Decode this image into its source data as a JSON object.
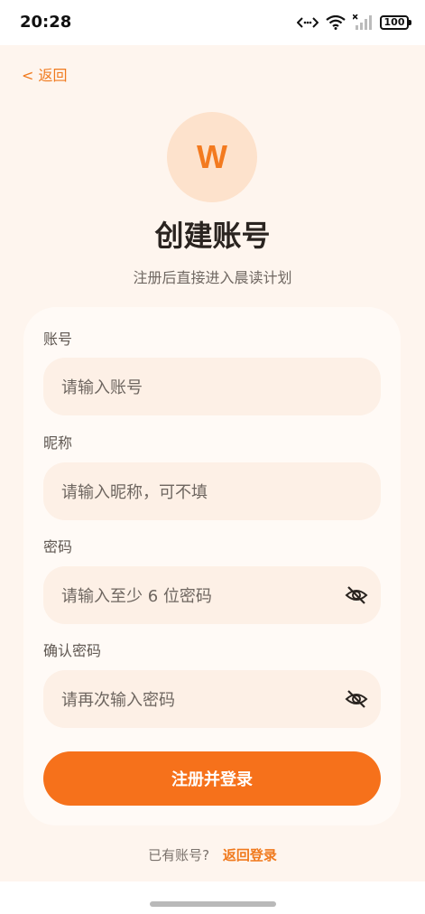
{
  "status_bar": {
    "time": "20:28",
    "battery": "100",
    "icons": [
      "signal-dots-icon",
      "wifi-icon",
      "cellular-icon",
      "battery-icon"
    ]
  },
  "nav": {
    "back_label": "< 返回"
  },
  "logo": {
    "letter": "W"
  },
  "header": {
    "title": "创建账号",
    "subtitle": "注册后直接进入晨读计划"
  },
  "form": {
    "account": {
      "label": "账号",
      "placeholder": "请输入账号"
    },
    "nickname": {
      "label": "昵称",
      "placeholder": "请输入昵称，可不填"
    },
    "password": {
      "label": "密码",
      "placeholder": "请输入至少 6 位密码"
    },
    "confirm_password": {
      "label": "确认密码",
      "placeholder": "请再次输入密码"
    },
    "submit_label": "注册并登录"
  },
  "footer": {
    "prompt": "已有账号?",
    "link": "返回登录"
  },
  "colors": {
    "accent": "#f6711b",
    "background": "#fef5ee",
    "card": "#fffaf6",
    "input": "#fdf0e6",
    "logo_bg": "#fde2cc"
  }
}
